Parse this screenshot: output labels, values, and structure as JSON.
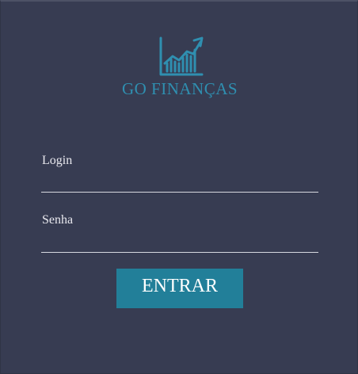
{
  "brand": {
    "name": "GO FINANÇAS",
    "logo_icon": "growth-chart-icon",
    "color": "#2f8fb0"
  },
  "form": {
    "login_label": "Login",
    "login_value": "",
    "password_label": "Senha",
    "password_value": "",
    "submit_label": "ENTRAR"
  },
  "colors": {
    "background": "#373c52",
    "accent": "#227f99",
    "text": "#e8e8ee"
  }
}
